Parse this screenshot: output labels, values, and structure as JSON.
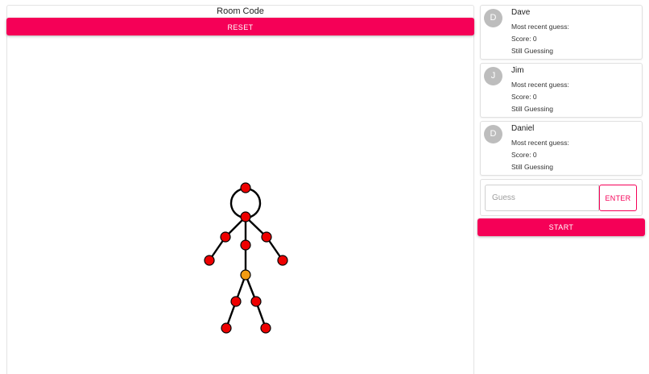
{
  "header": {
    "room_code_label": "Room Code",
    "reset_label": "RESET"
  },
  "players": [
    {
      "initial": "D",
      "name": "Dave",
      "recent_guess_label": "Most recent guess:",
      "score_text": "Score: 0",
      "status": "Still Guessing"
    },
    {
      "initial": "J",
      "name": "Jim",
      "recent_guess_label": "Most recent guess:",
      "score_text": "Score: 0",
      "status": "Still Guessing"
    },
    {
      "initial": "D",
      "name": "Daniel",
      "recent_guess_label": "Most recent guess:",
      "score_text": "Score: 0",
      "status": "Still Guessing"
    }
  ],
  "guess": {
    "placeholder": "Guess",
    "value": "",
    "enter_label": "ENTER"
  },
  "start_label": "START",
  "colors": {
    "accent": "#f50057",
    "avatar": "#bdbdbd",
    "joint": "#ee0000",
    "selected_joint": "#f39c12",
    "limb": "#000000"
  },
  "figure": {
    "type": "stick-figure",
    "joint_count": 14,
    "selected_joint": "hip"
  }
}
